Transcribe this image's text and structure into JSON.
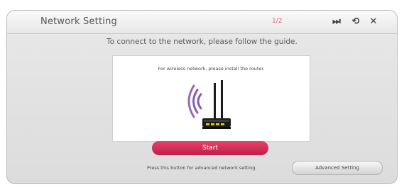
{
  "window": {
    "title": "Network Setting",
    "page_indicator": "1/2"
  },
  "controls": {
    "skip_icon": "skip-forward-icon",
    "back_icon": "back-icon",
    "close_icon": "close-icon",
    "skip_glyph": "⏭",
    "back_glyph": "⟲",
    "close_glyph": "✕"
  },
  "main": {
    "instruction": "To connect to the network, please follow the guide.",
    "panel_text": "For wireless network, please install the router.",
    "image_icon": "wireless-router-icon"
  },
  "buttons": {
    "start_label": "Start",
    "advanced_hint": "Press this button for advanced network setting.",
    "advanced_label": "Advanced Setting"
  },
  "colors": {
    "accent": "#d42a55",
    "wifi_waves": "#8a5bb0"
  }
}
